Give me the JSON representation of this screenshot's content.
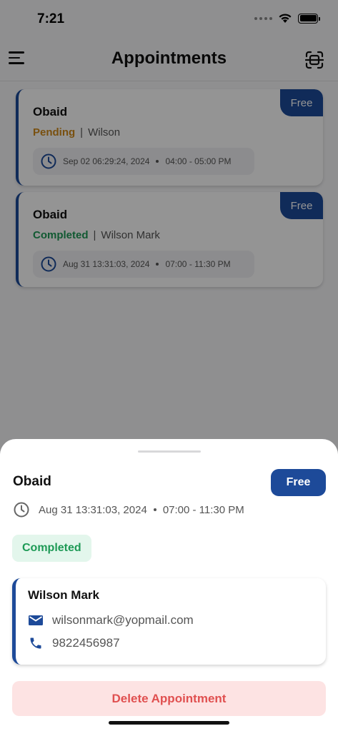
{
  "status_bar": {
    "time": "7:21"
  },
  "header": {
    "title": "Appointments"
  },
  "appointments": [
    {
      "name": "Obaid",
      "status": "Pending",
      "customer": "Wilson",
      "tag": "Free",
      "date": "Sep 02 06:29:24, 2024",
      "time_range": "04:00 - 05:00 PM"
    },
    {
      "name": "Obaid",
      "status": "Completed",
      "customer": "Wilson Mark",
      "tag": "Free",
      "date": "Aug 31 13:31:03, 2024",
      "time_range": "07:00 - 11:30 PM"
    }
  ],
  "separator": "|",
  "sheet": {
    "name": "Obaid",
    "tag": "Free",
    "date": "Aug 31 13:31:03, 2024",
    "time_range": "07:00 - 11:30 PM",
    "status": "Completed",
    "customer": {
      "name": "Wilson Mark",
      "email": "wilsonmark@yopmail.com",
      "phone": "9822456987"
    },
    "delete_label": "Delete Appointment"
  },
  "colors": {
    "primary": "#1d4a99",
    "pending": "#d08a1a",
    "completed": "#1e9a56",
    "danger": "#e05050"
  },
  "icons": {
    "menu": "menu-icon",
    "scan": "scan-icon",
    "clock": "clock-icon",
    "email": "email-icon",
    "phone": "phone-icon"
  }
}
